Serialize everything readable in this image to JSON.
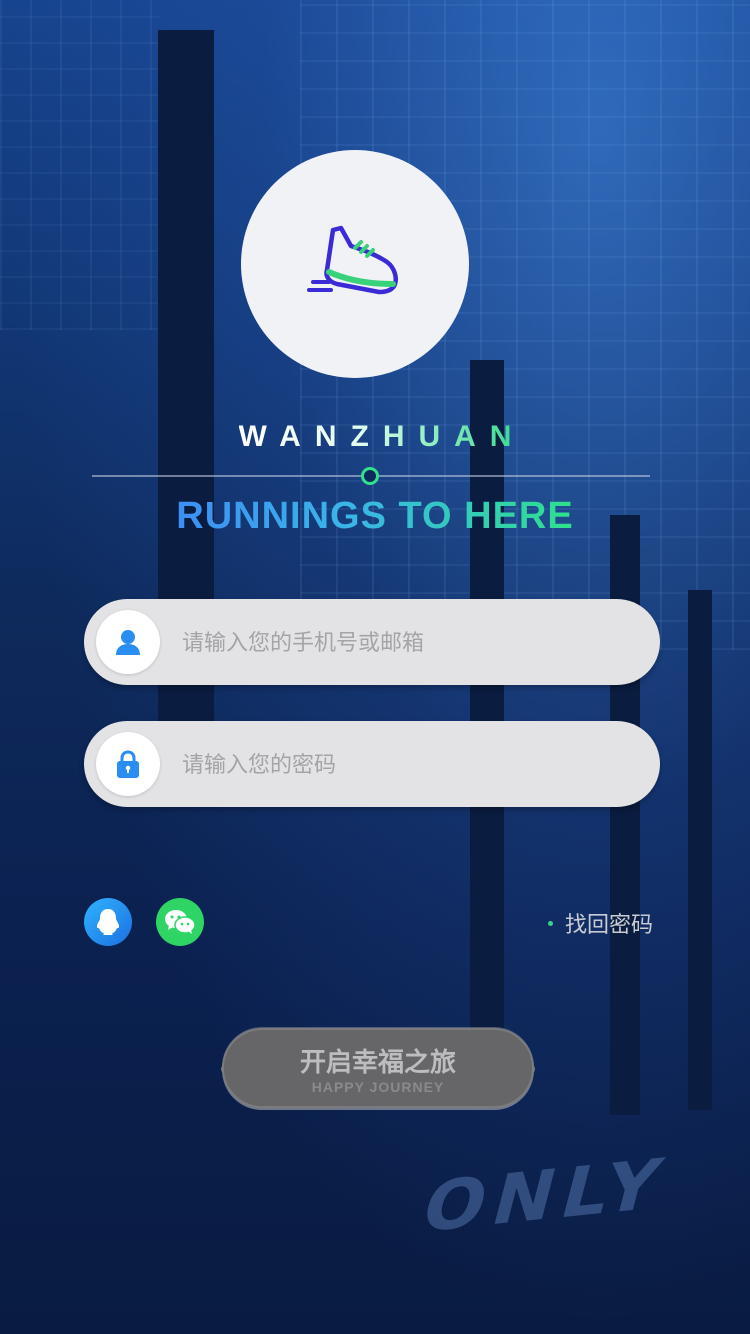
{
  "brand": {
    "name": "WANZHUAN",
    "tagline": "RUNNINGS TO HERE"
  },
  "icons": {
    "logo": "running-shoe-icon",
    "user": "user-icon",
    "lock": "lock-icon",
    "qq": "qq-icon",
    "wechat": "wechat-icon"
  },
  "login": {
    "account_placeholder": "请输入您的手机号或邮箱",
    "password_placeholder": "请输入您的密码",
    "forgot_label": "找回密码"
  },
  "start_button": {
    "label": "开启幸福之旅",
    "sublabel": "HAPPY JOURNEY"
  },
  "background": {
    "road_text": "ONLY"
  },
  "colors": {
    "accent_green": "#2fe08b",
    "accent_blue": "#3d8ef5",
    "icon_blue": "#2a8ef0"
  }
}
